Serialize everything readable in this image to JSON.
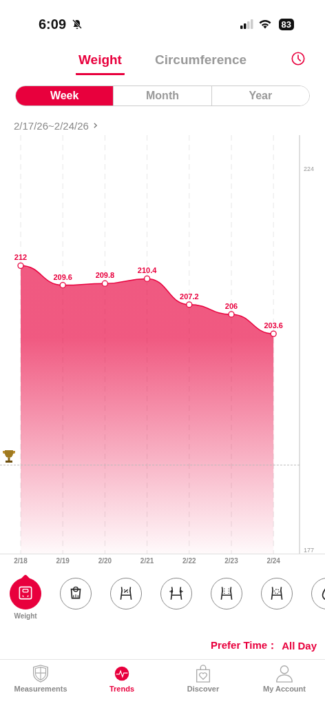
{
  "status_bar": {
    "time": "6:09",
    "battery": "83"
  },
  "tabs": [
    {
      "label": "Weight",
      "selected": true
    },
    {
      "label": "Circumference",
      "selected": false
    }
  ],
  "periods": [
    {
      "label": "Week",
      "selected": true
    },
    {
      "label": "Month",
      "selected": false
    },
    {
      "label": "Year",
      "selected": false
    }
  ],
  "date_range": "2/17/26~2/24/26",
  "chart_data": {
    "type": "area",
    "categories": [
      "2/18",
      "2/19",
      "2/20",
      "2/21",
      "2/22",
      "2/23",
      "2/24"
    ],
    "series": [
      {
        "color": "#e8003d",
        "values": [
          212,
          209.6,
          209.8,
          210.4,
          207.2,
          206,
          203.6
        ]
      }
    ],
    "value_labels": [
      "212",
      "209.6",
      "209.8",
      "210.4",
      "207.2",
      "206",
      "203.6"
    ],
    "ylim": [
      176.4,
      228.1
    ],
    "yticks": [
      224,
      177
    ],
    "grid": true
  },
  "metrics": [
    {
      "kind": "scale",
      "label": "Weight",
      "selected": true
    },
    {
      "kind": "body-fat-scale",
      "selected": false
    },
    {
      "kind": "body-fat",
      "selected": false
    },
    {
      "kind": "waist",
      "selected": false
    },
    {
      "kind": "muscle",
      "selected": false
    },
    {
      "kind": "visceral",
      "selected": false
    },
    {
      "kind": "water",
      "selected": false
    }
  ],
  "prefer_time": {
    "label": "Prefer Time：",
    "value": "All Day"
  },
  "nav": [
    {
      "kind": "shield",
      "label": "Measurements",
      "selected": false
    },
    {
      "kind": "pulse",
      "label": "Trends",
      "selected": true
    },
    {
      "kind": "bag",
      "label": "Discover",
      "selected": false
    },
    {
      "kind": "person",
      "label": "My Account",
      "selected": false
    }
  ]
}
